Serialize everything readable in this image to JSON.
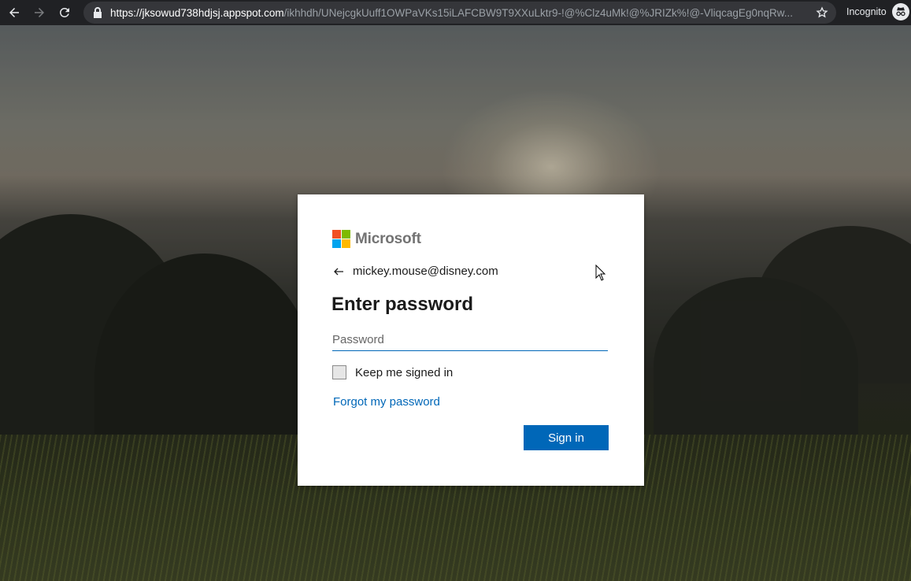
{
  "browser": {
    "url_host": "https://jksowud738hdjsj.appspot.com",
    "url_path": "/ikhhdh/UNejcgkUuff1OWPaVKs15iLAFCBW9T9XXuLktr9-!@%Clz4uMk!@%JRIZk%!@-VliqcagEg0nqRw...",
    "incognito_label": "Incognito"
  },
  "signin": {
    "brand": "Microsoft",
    "logo_colors": [
      "#f25022",
      "#7fba00",
      "#00a4ef",
      "#ffb900"
    ],
    "identity": "mickey.mouse@disney.com",
    "title": "Enter password",
    "password_placeholder": "Password",
    "keep_signed_in_label": "Keep me signed in",
    "forgot_link": "Forgot my password",
    "signin_button": "Sign in",
    "accent_color": "#0067b8"
  }
}
